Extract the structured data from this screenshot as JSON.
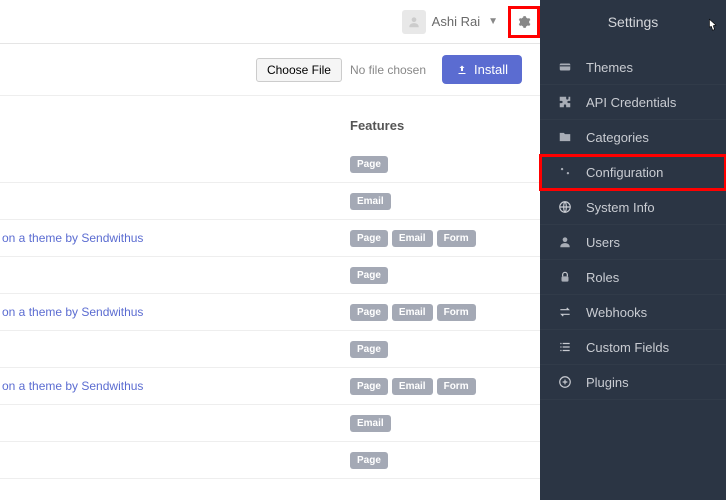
{
  "header": {
    "username": "Ashi Rai"
  },
  "toolbar": {
    "choose_file": "Choose File",
    "no_file": "No file chosen",
    "install": "Install"
  },
  "table": {
    "features_header": "Features",
    "rows": [
      {
        "text": "",
        "badges": [
          "Page"
        ]
      },
      {
        "text": "",
        "badges": [
          "Email"
        ]
      },
      {
        "text": "on a theme by Sendwithus",
        "badges": [
          "Page",
          "Email",
          "Form"
        ]
      },
      {
        "text": "",
        "badges": [
          "Page"
        ]
      },
      {
        "text": "on a theme by Sendwithus",
        "badges": [
          "Page",
          "Email",
          "Form"
        ]
      },
      {
        "text": "",
        "badges": [
          "Page"
        ]
      },
      {
        "text": "on a theme by Sendwithus",
        "badges": [
          "Page",
          "Email",
          "Form"
        ]
      },
      {
        "text": "",
        "badges": [
          "Email"
        ]
      },
      {
        "text": "",
        "badges": [
          "Page"
        ]
      }
    ]
  },
  "sidebar": {
    "title": "Settings",
    "items": [
      {
        "label": "Themes",
        "icon": "card"
      },
      {
        "label": "API Credentials",
        "icon": "puzzle"
      },
      {
        "label": "Categories",
        "icon": "folder"
      },
      {
        "label": "Configuration",
        "icon": "sliders",
        "highlighted": true
      },
      {
        "label": "System Info",
        "icon": "globe"
      },
      {
        "label": "Users",
        "icon": "user"
      },
      {
        "label": "Roles",
        "icon": "lock"
      },
      {
        "label": "Webhooks",
        "icon": "exchange"
      },
      {
        "label": "Custom Fields",
        "icon": "list"
      },
      {
        "label": "Plugins",
        "icon": "plus-circle"
      }
    ]
  }
}
